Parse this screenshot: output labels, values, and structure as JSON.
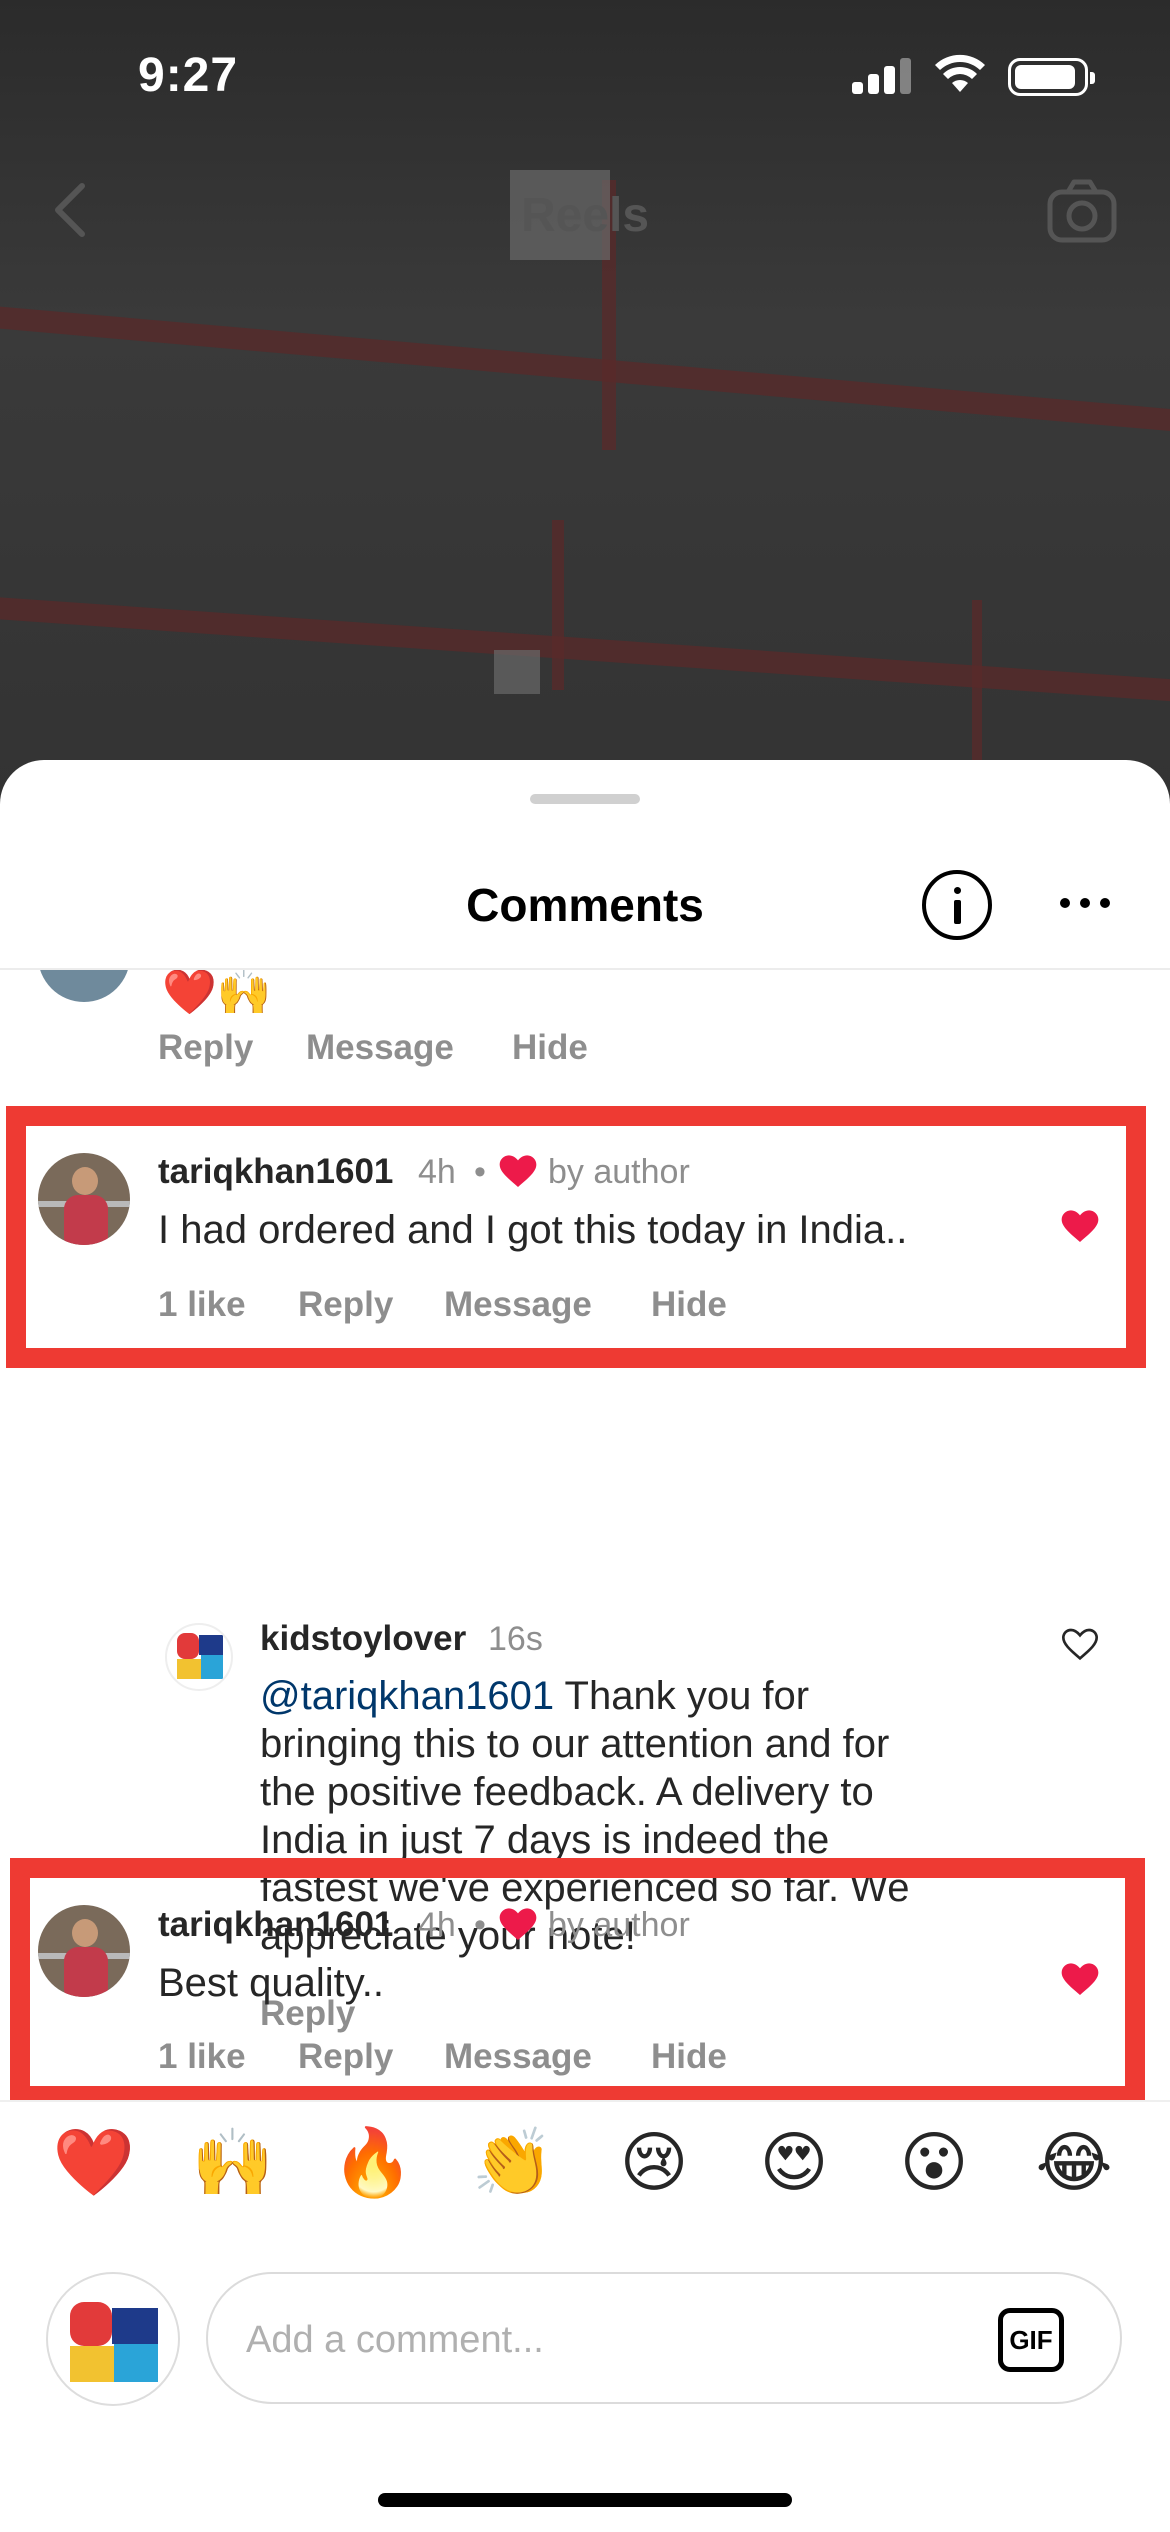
{
  "status_bar": {
    "time": "9:27"
  },
  "header": {
    "title": "Reels"
  },
  "sheet": {
    "title": "Comments"
  },
  "previous_comment": {
    "emojis": "❤️🙌",
    "actions": {
      "reply": "Reply",
      "message": "Message",
      "hide": "Hide"
    }
  },
  "comments": [
    {
      "username": "tariqkhan1601",
      "time": "4h",
      "separator": "•",
      "by_author": "by author",
      "text": "I had ordered and I got this today in India..",
      "likes": "1 like",
      "actions": {
        "reply": "Reply",
        "message": "Message",
        "hide": "Hide"
      },
      "liked": true
    },
    {
      "username": "kidstoylover",
      "time": "16s",
      "mention": "@tariqkhan1601",
      "text_lines": [
        " Thank you for",
        "bringing this to our attention and for",
        "the positive feedback. A delivery to",
        "India in just 7 days is indeed the",
        "fastest we've experienced so far. We",
        "appreciate your note!"
      ],
      "actions": {
        "reply": "Reply"
      },
      "liked": false
    },
    {
      "username": "tariqkhan1601",
      "time": "4h",
      "separator": "•",
      "by_author": "by author",
      "text": "Best quality..",
      "likes": "1 like",
      "actions": {
        "reply": "Reply",
        "message": "Message",
        "hide": "Hide"
      },
      "liked": true
    }
  ],
  "emoji_bar": [
    "❤️",
    "🙌",
    "🔥",
    "👏",
    "😢",
    "😍",
    "😮",
    "😂"
  ],
  "composer": {
    "placeholder": "Add a comment...",
    "gif_label": "GIF"
  },
  "colors": {
    "highlight": "#ee3a33",
    "like": "#ed1a4a",
    "mention": "#00376b"
  }
}
